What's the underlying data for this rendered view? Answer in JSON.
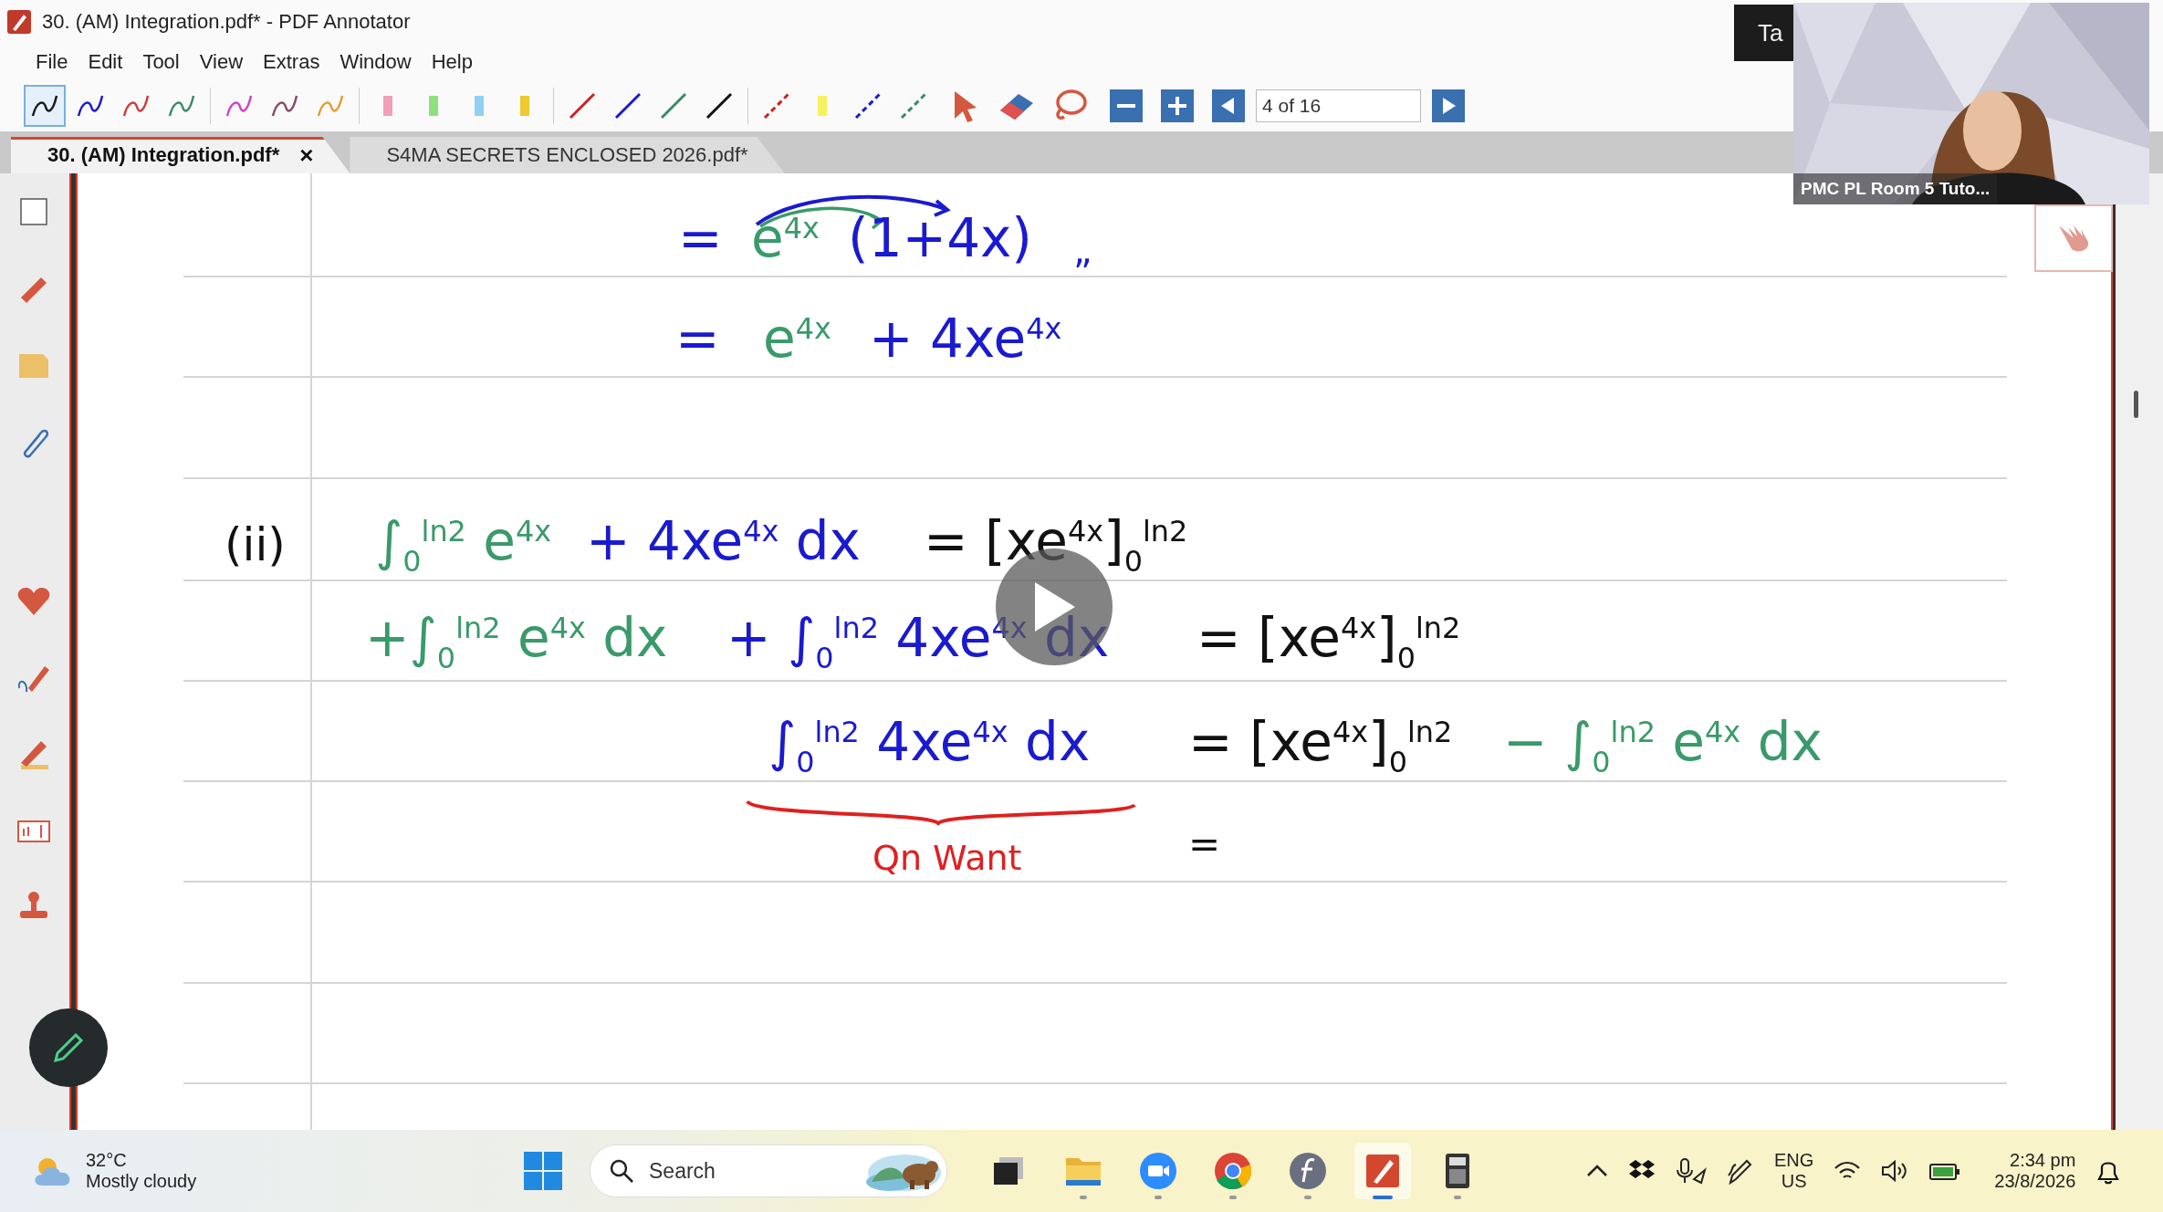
{
  "window": {
    "title": "30. (AM) Integration.pdf* - PDF Annotator"
  },
  "menu": [
    "File",
    "Edit",
    "Tool",
    "View",
    "Extras",
    "Window",
    "Help"
  ],
  "toolbar": {
    "tools": [
      {
        "kind": "pen",
        "color": "#1a1a1a",
        "selected": true
      },
      {
        "kind": "pen",
        "color": "#1a1ad0",
        "selected": false
      },
      {
        "kind": "pen",
        "color": "#d23a3a",
        "selected": false
      },
      {
        "kind": "pen",
        "color": "#3a8a6a",
        "selected": false
      },
      {
        "kind": "pen",
        "color": "#d040d0",
        "selected": false
      },
      {
        "kind": "pen",
        "color": "#8a4a6a",
        "selected": false
      },
      {
        "kind": "pen",
        "color": "#e0a030",
        "selected": false
      },
      {
        "kind": "highlighter",
        "color": "#f0a0b8",
        "selected": false
      },
      {
        "kind": "highlighter",
        "color": "#90e080",
        "selected": false
      },
      {
        "kind": "highlighter",
        "color": "#90d0f0",
        "selected": false
      },
      {
        "kind": "highlighter",
        "color": "#f0c830",
        "selected": false
      },
      {
        "kind": "line",
        "color": "#d02020",
        "selected": false
      },
      {
        "kind": "line",
        "color": "#1a1ad0",
        "selected": false
      },
      {
        "kind": "line",
        "color": "#3a8a6a",
        "selected": false
      },
      {
        "kind": "line",
        "color": "#111111",
        "selected": false
      },
      {
        "kind": "dashed",
        "color": "#d02020",
        "selected": false
      },
      {
        "kind": "highlighter",
        "color": "#f8f060",
        "selected": false
      },
      {
        "kind": "dashed",
        "color": "#1a1ad0",
        "selected": false
      },
      {
        "kind": "dashed",
        "color": "#3a8a6a",
        "selected": false
      }
    ],
    "page_field": "4 of 16"
  },
  "tabs": [
    {
      "label": "30. (AM) Integration.pdf*",
      "selected": true,
      "close": "×"
    },
    {
      "label": "S4MA SECRETS ENCLOSED 2026.pdf*",
      "selected": false
    }
  ],
  "ink": [
    {
      "text": "=",
      "color": "#1a1ad0"
    },
    {
      "text": "e$^{4x}$",
      "color": "#3a9a6a"
    },
    {
      "text": "(1+4x)",
      "color": "#1a1ad0"
    },
    {
      "text": "„",
      "color": "#1a1ad0"
    },
    {
      "text": "=",
      "color": "#1a1ad0"
    },
    {
      "text": "e$^{4x}$",
      "color": "#3a9a6a"
    },
    {
      "text": "+ 4xe$^{4x}$",
      "color": "#1a1ad0"
    },
    {
      "text": "(ii)",
      "color": "#111111"
    },
    {
      "text": "∫$_{0}$$^{ln2}$ e$^{4x}$",
      "color": "#3a9a6a"
    },
    {
      "text": "+ 4xe$^{4x}$ dx",
      "color": "#1a1ad0"
    },
    {
      "text": "= [xe$^{4x}$]$_{0}$$^{ln2}$",
      "color": "#111111"
    },
    {
      "text": "+∫$_{0}$$^{ln2}$ e$^{4x}$ dx",
      "color": "#3a9a6a"
    },
    {
      "text": "+ ∫$_{0}$$^{ln2}$ 4xe$^{4x}$ dx",
      "color": "#1a1ad0"
    },
    {
      "text": "= [xe$^{4x}$]$_{0}$$^{ln2}$",
      "color": "#111111"
    },
    {
      "text": "∫$_{0}$$^{ln2}$ 4xe$^{4x}$ dx",
      "color": "#1a1ad0"
    },
    {
      "text": "= [xe$^{4x}$]$_{0}$$^{ln2}$",
      "color": "#111111"
    },
    {
      "text": "− ∫$_{0}$$^{ln2}$ e$^{4x}$ dx",
      "color": "#3a9a6a"
    },
    {
      "text": "Qn Want",
      "color": "#e02020"
    },
    {
      "text": "=",
      "color": "#111111"
    }
  ],
  "tooltip": "Ta",
  "video": {
    "name": "PMC PL Room 5 Tuto..."
  },
  "taskbar": {
    "weather": {
      "temperature": "32°C",
      "condition": "Mostly cloudy"
    },
    "search": {
      "placeholder": "Search"
    },
    "apps": [
      {
        "kind": "task-view",
        "selected": false
      },
      {
        "kind": "folder",
        "selected": false
      },
      {
        "kind": "video-call",
        "selected": false
      },
      {
        "kind": "browser",
        "selected": false
      },
      {
        "kind": "f-app",
        "selected": false
      },
      {
        "kind": "annotator",
        "selected": true
      },
      {
        "kind": "calculator",
        "selected": false
      }
    ],
    "language": "ENG",
    "region": "US",
    "time": "2:34 pm",
    "date": "23/8/2026"
  }
}
